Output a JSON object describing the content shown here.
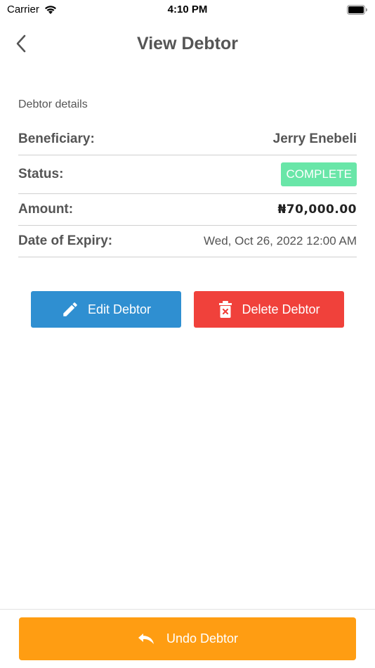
{
  "status_bar": {
    "carrier": "Carrier",
    "time": "4:10 PM"
  },
  "header": {
    "title": "View Debtor",
    "back_icon": "chevron-left-icon"
  },
  "details": {
    "section_label": "Debtor details",
    "beneficiary": {
      "label": "Beneficiary:",
      "value": "Jerry Enebeli"
    },
    "status": {
      "label": "Status:",
      "value": "COMPLETE",
      "color": "#69e6a8"
    },
    "amount": {
      "label": "Amount:",
      "value": "₦70,000.00"
    },
    "expiry": {
      "label": "Date of Expiry:",
      "value": "Wed, Oct 26, 2022 12:00 AM"
    }
  },
  "actions": {
    "edit": {
      "label": "Edit Debtor",
      "icon": "pencil-icon",
      "color": "#2f8fd1"
    },
    "delete": {
      "label": "Delete Debtor",
      "icon": "trash-icon",
      "color": "#f0413b"
    },
    "undo": {
      "label": "Undo Debtor",
      "icon": "undo-icon",
      "color": "#ff9d12"
    }
  }
}
